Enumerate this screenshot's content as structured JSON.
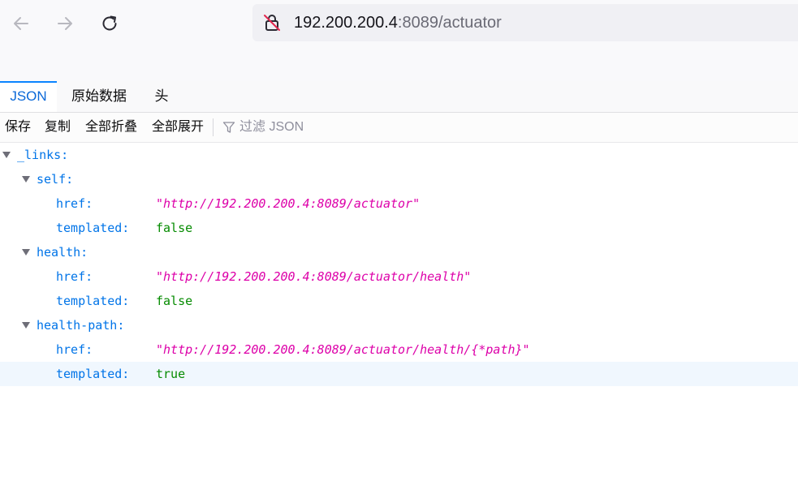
{
  "browser": {
    "url_host": "192.200.200.4",
    "url_rest": ":8089/actuator"
  },
  "viewer_tabs": {
    "json": "JSON",
    "raw": "原始数据",
    "headers": "头"
  },
  "toolbar": {
    "save": "保存",
    "copy": "复制",
    "collapse_all": "全部折叠",
    "expand_all": "全部展开",
    "filter_placeholder": "过滤 JSON"
  },
  "tree": {
    "root_key": "_links:",
    "self": {
      "key": "self:",
      "href_key": "href:",
      "href_value": "http://192.200.200.4:8089/actuator",
      "templated_key": "templated:",
      "templated_value": "false"
    },
    "health": {
      "key": "health:",
      "href_key": "href:",
      "href_value": "http://192.200.200.4:8089/actuator/health",
      "templated_key": "templated:",
      "templated_value": "false"
    },
    "health_path": {
      "key": "health-path:",
      "href_key": "href:",
      "href_value": "http://192.200.200.4:8089/actuator/health/{*path}",
      "templated_key": "templated:",
      "templated_value": "true"
    }
  },
  "colors": {
    "key": "#0074e8",
    "string": "#dd00a9",
    "boolean": "#058b00",
    "active_tab": "#0a68d8",
    "selected_row": "#f0f7fe"
  },
  "icons": {
    "back": "back-arrow-icon",
    "forward": "forward-arrow-icon",
    "reload": "reload-icon",
    "lock": "insecure-lock-icon",
    "filter": "filter-icon",
    "twisty": "expand-triangle-icon"
  }
}
